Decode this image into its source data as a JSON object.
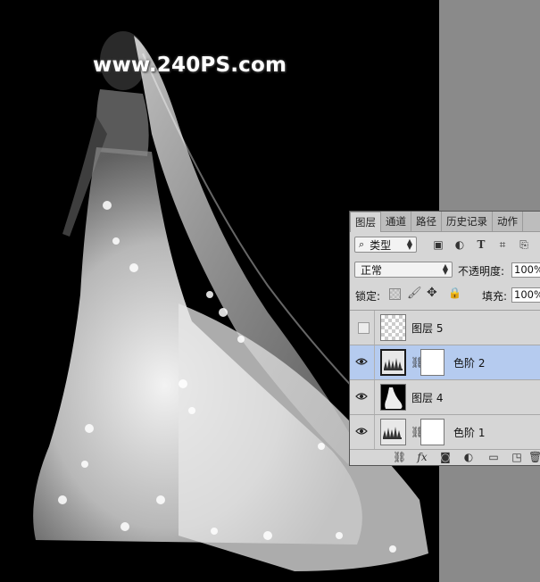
{
  "watermark": "www.240PS.com",
  "panel": {
    "tabs": [
      "图层",
      "通道",
      "路径",
      "历史记录",
      "动作"
    ],
    "active_tab": 0,
    "filter": {
      "label": "类型",
      "icons": [
        "image-filter-icon",
        "adjustment-filter-icon",
        "type-filter-icon",
        "shape-filter-icon",
        "smart-object-filter-icon"
      ]
    },
    "blend_mode": "正常",
    "opacity_label": "不透明度:",
    "opacity_value": "100%",
    "lock_label": "锁定:",
    "fill_label": "填充:",
    "fill_value": "100%",
    "layers": [
      {
        "name": "图层 5",
        "visible": false,
        "type": "pixel-transparent",
        "selected": false
      },
      {
        "name": "色阶 2",
        "visible": true,
        "type": "levels-adjustment",
        "selected": true
      },
      {
        "name": "图层 4",
        "visible": true,
        "type": "pixel-dress",
        "selected": false
      },
      {
        "name": "色阶 1",
        "visible": true,
        "type": "levels-adjustment",
        "selected": false
      }
    ],
    "bottom_icons": [
      "link-layers-icon",
      "fx-icon",
      "add-mask-icon",
      "new-adjustment-icon",
      "new-group-icon",
      "new-layer-icon",
      "delete-layer-icon"
    ],
    "fx_text": "fx",
    "colors": {
      "selected_row": "#b5cbef",
      "panel_bg": "#d6d6d6",
      "canvas_bg": "#000000",
      "outside_canvas": "#8a8a8a"
    }
  }
}
